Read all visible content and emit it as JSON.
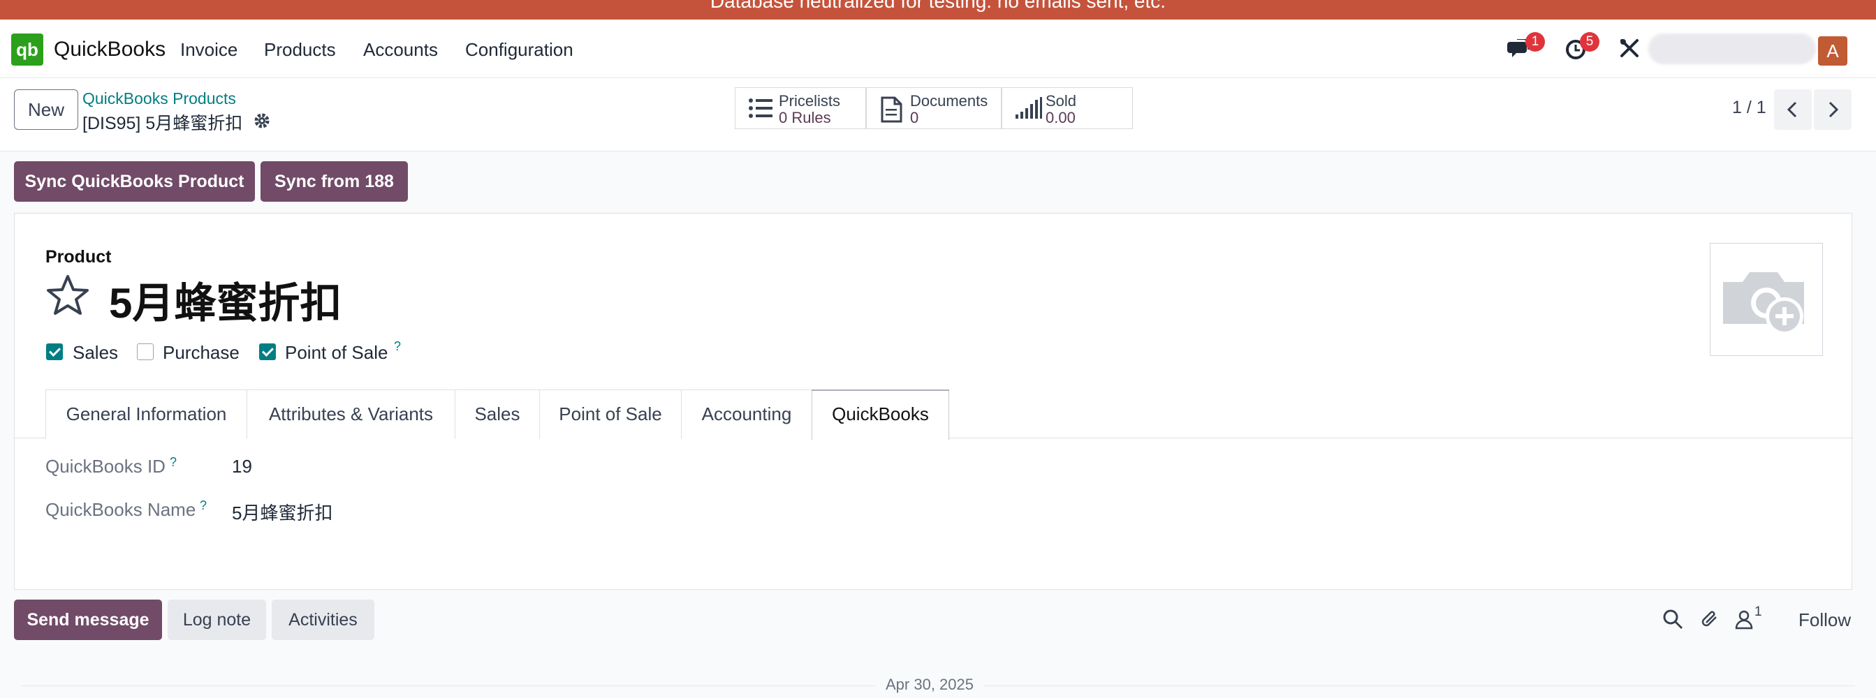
{
  "banner": {
    "text": "Database neutralized for testing: no emails sent, etc."
  },
  "navbar": {
    "app_name": "QuickBooks",
    "logo_text": "qb",
    "menu": [
      "Invoice",
      "Products",
      "Accounts",
      "Configuration"
    ],
    "messages_badge": "1",
    "activities_badge": "5",
    "avatar_letter": "A",
    "colors": {
      "brand": "#2ca01c",
      "primary": "#714b67",
      "badge": "#e0343c",
      "banner": "#c5533b"
    }
  },
  "control": {
    "new_label": "New",
    "breadcrumb_parent": "QuickBooks Products",
    "breadcrumb_current": "[DIS95] 5月蜂蜜折扣",
    "smart_buttons": [
      {
        "icon": "list-icon",
        "title": "Pricelists",
        "value": "0 Rules"
      },
      {
        "icon": "document-icon",
        "title": "Documents",
        "value": "0"
      },
      {
        "icon": "signal-bars-icon",
        "title": "Sold",
        "value": "0.00"
      }
    ],
    "pager": "1 / 1"
  },
  "actions": {
    "sync_product": "Sync QuickBooks Product",
    "sync_from": "Sync from 188"
  },
  "form": {
    "label": "Product",
    "title": "5月蜂蜜折扣",
    "checkboxes": [
      {
        "label": "Sales",
        "checked": true
      },
      {
        "label": "Purchase",
        "checked": false
      },
      {
        "label": "Point of Sale",
        "checked": true,
        "help": "?"
      }
    ],
    "tabs": [
      "General Information",
      "Attributes & Variants",
      "Sales",
      "Point of Sale",
      "Accounting",
      "QuickBooks"
    ],
    "active_tab": "QuickBooks",
    "fields": [
      {
        "label": "QuickBooks ID",
        "help": "?",
        "value": "19"
      },
      {
        "label": "QuickBooks Name",
        "help": "?",
        "value": "5月蜂蜜折扣"
      }
    ]
  },
  "chatter": {
    "send_message": "Send message",
    "log_note": "Log note",
    "activities": "Activities",
    "followers_count": "1",
    "follow": "Follow",
    "date": "Apr 30, 2025"
  }
}
